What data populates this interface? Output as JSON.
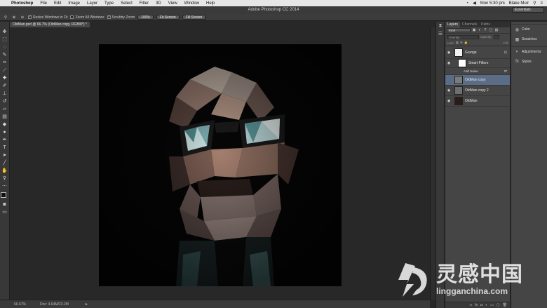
{
  "menubar": {
    "app_name": "Photoshop",
    "items": [
      "File",
      "Edit",
      "Image",
      "Layer",
      "Type",
      "Select",
      "Filter",
      "3D",
      "View",
      "Window",
      "Help"
    ],
    "clock": "Mon 5:30 pm",
    "user": "Blake Muir"
  },
  "window": {
    "title": "Adobe Photoshop CC 2014",
    "workspace": "Essentials"
  },
  "options": {
    "resize_windows": "Resize Windows to Fit",
    "zoom_all": "Zoom All Windows",
    "scrubby_zoom": "Scrubby Zoom",
    "btn_100": "100%",
    "btn_fit": "Fit Screen",
    "btn_fill": "Fill Screen"
  },
  "document": {
    "tab_label": "OldMan.psd @ 66.7% (OldMan copy, RGB/8*) *",
    "zoom": "66.67%",
    "doc_size": "Doc: 4.64M/23.2M"
  },
  "layers_panel": {
    "tabs": [
      "Layers",
      "Channels",
      "Paths"
    ],
    "kind": "Kind",
    "blend_mode": "Overlay",
    "opacity_label": "Opacity:",
    "lock_label": "Lock:",
    "fill_label": "Fill:",
    "layers": [
      {
        "name": "Grunge",
        "visible": true,
        "selected": false
      },
      {
        "name": "Smart Filters",
        "visible": true,
        "selected": false
      },
      {
        "name": "Add Noise",
        "visible": false,
        "selected": false
      },
      {
        "name": "OldMan copy",
        "visible": false,
        "selected": true
      },
      {
        "name": "OldMan copy 2",
        "visible": true,
        "selected": false
      },
      {
        "name": "OldMan",
        "visible": true,
        "selected": false
      }
    ]
  },
  "right_panel": {
    "items": [
      "Color",
      "Swatches",
      "Adjustments",
      "Styles"
    ]
  },
  "watermark": {
    "chinese": "灵感中国",
    "domain": "lingganchina.com"
  }
}
